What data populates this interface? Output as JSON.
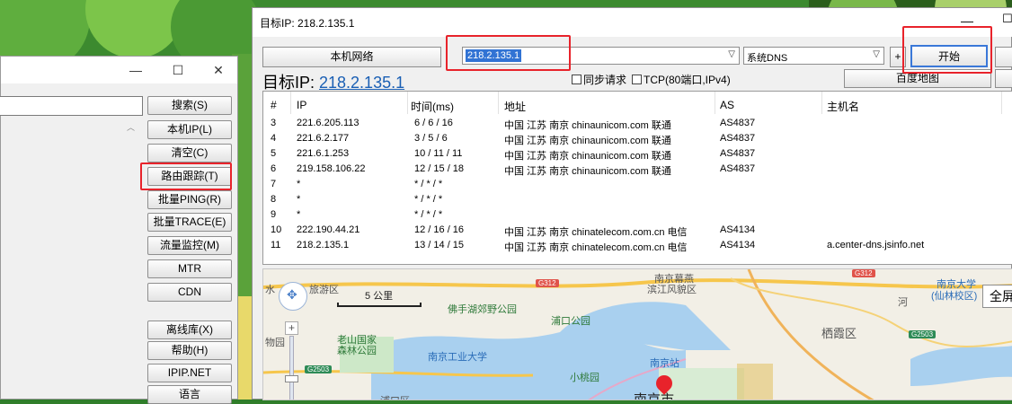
{
  "back_window": {
    "buttons": [
      "搜索(S)",
      "本机IP(L)",
      "清空(C)",
      "路由跟踪(T)",
      "批量PING(R)",
      "批量TRACE(E)",
      "流量监控(M)",
      "MTR",
      "CDN",
      "离线库(X)",
      "帮助(H)",
      "IPIP.NET",
      "语言"
    ],
    "highlighted": "路由跟踪(T)"
  },
  "front_window": {
    "title": "目标IP: 218.2.135.1",
    "local_network_button": "本机网络",
    "ip_input_value": "218.2.135.1",
    "dns_select_value": "系统DNS",
    "plus_button": "+",
    "start_button": "开始",
    "target_label": "目标IP: ",
    "target_ip": "218.2.135.1",
    "sync_request_label": "同步请求",
    "tcp_label": "TCP(80端口,IPv4)",
    "baidu_map_button": "百度地图"
  },
  "table": {
    "headers": [
      "#",
      "IP",
      "时间(ms)",
      "地址",
      "AS",
      "主机名"
    ],
    "rows": [
      [
        "3",
        "221.6.205.113",
        "6 / 6 / 16",
        "中国 江苏 南京 chinaunicom.com 联通",
        "AS4837",
        ""
      ],
      [
        "4",
        "221.6.2.177",
        "3 / 5 / 6",
        "中国 江苏 南京 chinaunicom.com 联通",
        "AS4837",
        ""
      ],
      [
        "5",
        "221.6.1.253",
        "10 / 11 / 11",
        "中国 江苏 南京 chinaunicom.com 联通",
        "AS4837",
        ""
      ],
      [
        "6",
        "219.158.106.22",
        "12 / 15 / 18",
        "中国 江苏 南京 chinaunicom.com 联通",
        "AS4837",
        ""
      ],
      [
        "7",
        "*",
        "* / * / *",
        "",
        "",
        ""
      ],
      [
        "8",
        "*",
        "* / * / *",
        "",
        "",
        ""
      ],
      [
        "9",
        "*",
        "* / * / *",
        "",
        "",
        ""
      ],
      [
        "10",
        "222.190.44.21",
        "12 / 16 / 16",
        "中国 江苏 南京 chinatelecom.com.cn 电信",
        "AS4134",
        ""
      ],
      [
        "11",
        "218.2.135.1",
        "13 / 14 / 15",
        "中国 江苏 南京 chinatelecom.com.cn 电信",
        "AS4134",
        "a.center-dns.jsinfo.net"
      ]
    ]
  },
  "map": {
    "scale_label": "5 公里",
    "fullscreen_button": "全屏",
    "labels": [
      "水",
      "旅游区",
      "南京幕燕",
      "滨江风貌区",
      "南京大学",
      "(仙林校区)",
      "佛手湖郊野公园",
      "浦口公园",
      "老山国家",
      "森林公园",
      "南京工业大学",
      "物园",
      "南京站",
      "小桃园",
      "栖霞区",
      "河",
      "浦口区",
      "南京市"
    ],
    "road_shields": [
      "G312",
      "G312",
      "G2503",
      "G2503"
    ]
  }
}
